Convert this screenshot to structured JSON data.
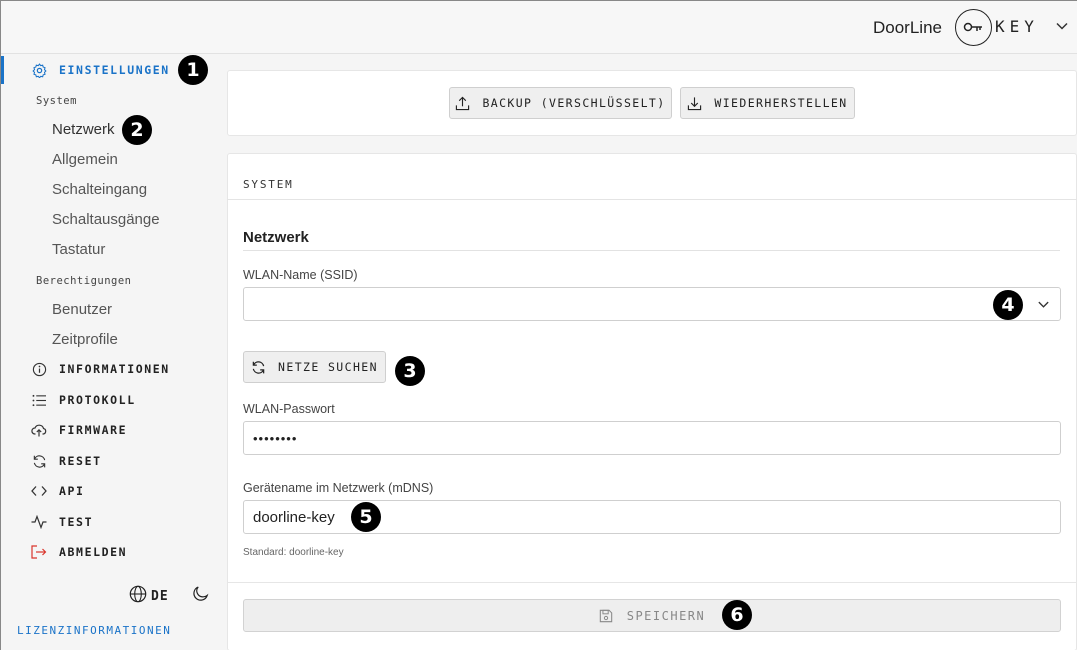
{
  "header": {
    "brand_name": "DoorLine",
    "brand_suffix": "KEY"
  },
  "sidebar": {
    "settings_label": "EINSTELLUNGEN",
    "group_system": "System",
    "system_items": [
      "Netzwerk",
      "Allgemein",
      "Schalteingang",
      "Schaltausgänge",
      "Tastatur"
    ],
    "group_permissions": "Berechtigungen",
    "permission_items": [
      "Benutzer",
      "Zeitprofile"
    ],
    "nav": [
      {
        "label": "INFORMATIONEN",
        "icon": "info-icon"
      },
      {
        "label": "PROTOKOLL",
        "icon": "list-icon"
      },
      {
        "label": "FIRMWARE",
        "icon": "cloud-upload-icon"
      },
      {
        "label": "RESET",
        "icon": "refresh-icon"
      },
      {
        "label": "API",
        "icon": "code-icon"
      },
      {
        "label": "TEST",
        "icon": "activity-icon"
      },
      {
        "label": "ABMELDEN",
        "icon": "logout-icon"
      }
    ],
    "language": "DE",
    "license_label": "LIZENZINFORMATIONEN"
  },
  "backup": {
    "backup_label": "BACKUP (VERSCHLÜSSELT)",
    "restore_label": "WIEDERHERSTELLEN"
  },
  "system": {
    "section_title": "SYSTEM",
    "network_heading": "Netzwerk",
    "ssid_label": "WLAN-Name (SSID)",
    "ssid_value": "",
    "scan_label": "NETZE SUCHEN",
    "password_label": "WLAN-Passwort",
    "password_value": "••••••••",
    "hostname_label": "Gerätename im Netzwerk (mDNS)",
    "hostname_value": "doorline-key",
    "hostname_hint": "Standard: doorline-key",
    "save_label": "SPEICHERN"
  },
  "callouts": [
    "1",
    "2",
    "3",
    "4",
    "5",
    "6"
  ],
  "colors": {
    "accent": "#1a73c8",
    "danger": "#d9342b"
  }
}
